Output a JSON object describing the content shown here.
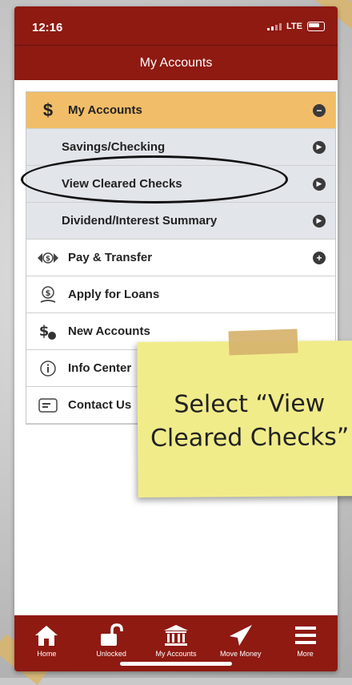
{
  "status": {
    "time": "12:16",
    "network": "LTE"
  },
  "nav": {
    "title": "My Accounts"
  },
  "menu": {
    "header": {
      "label": "My Accounts",
      "icon": "dollar-icon",
      "toggle": "minus-circle-icon"
    },
    "subitems": [
      {
        "label": "Savings/Checking"
      },
      {
        "label": "View Cleared Checks"
      },
      {
        "label": "Dividend/Interest Summary"
      }
    ],
    "items": [
      {
        "label": "Pay & Transfer",
        "icon": "money-transfer-icon",
        "trail": "plus-circle-icon"
      },
      {
        "label": "Apply for Loans",
        "icon": "loan-hand-icon"
      },
      {
        "label": "New Accounts",
        "icon": "new-account-icon"
      },
      {
        "label": "Info Center",
        "icon": "info-icon"
      },
      {
        "label": "Contact Us",
        "icon": "contact-card-icon"
      }
    ]
  },
  "tabs": [
    {
      "label": "Home",
      "icon": "home-icon"
    },
    {
      "label": "Unlocked",
      "icon": "unlock-icon"
    },
    {
      "label": "My Accounts",
      "icon": "bank-icon"
    },
    {
      "label": "Move Money",
      "icon": "paper-plane-icon"
    },
    {
      "label": "More",
      "icon": "hamburger-menu-icon"
    }
  ],
  "callout": {
    "text": "Select “View\nCleared Checks”"
  },
  "colors": {
    "brand": "#8e1a12",
    "header": "#f1bd68",
    "submenu": "#e2e5ea",
    "note": "#f1ec8a"
  }
}
